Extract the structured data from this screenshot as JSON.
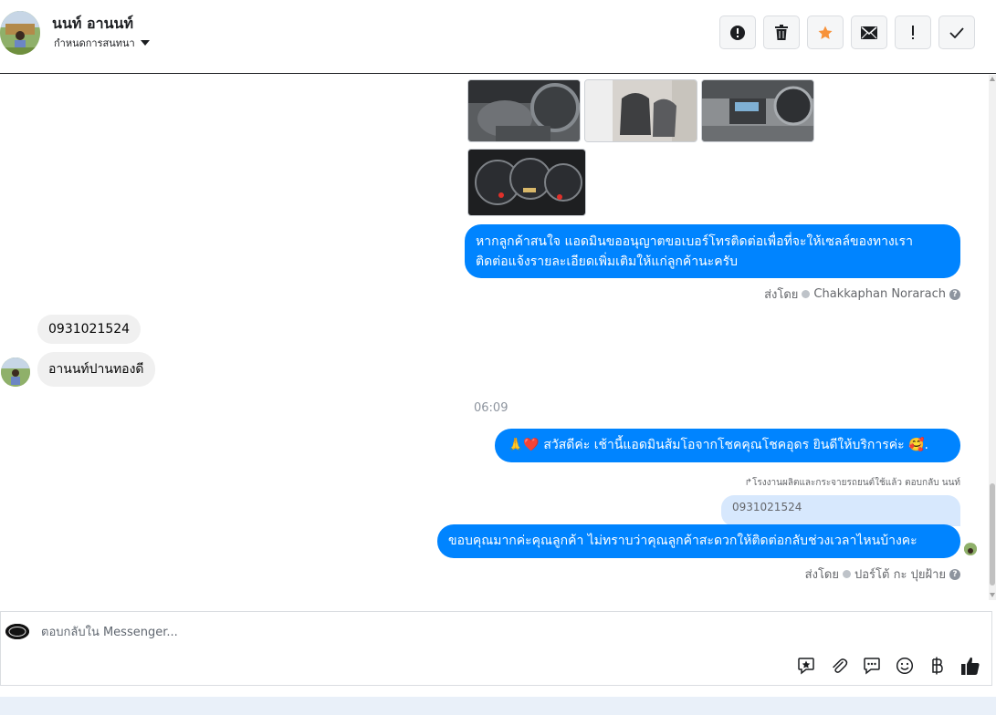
{
  "header": {
    "contact_name": "นนท์ อานนท์",
    "status_label": "กำหนดการสนทนา",
    "actions": [
      {
        "id": "spam",
        "icon": "alert-circle-icon"
      },
      {
        "id": "delete",
        "icon": "trash-icon"
      },
      {
        "id": "star",
        "icon": "star-icon"
      },
      {
        "id": "mail",
        "icon": "envelope-icon"
      },
      {
        "id": "important",
        "icon": "exclamation-icon"
      },
      {
        "id": "done",
        "icon": "check-icon"
      }
    ],
    "accent_color": "#f7923a"
  },
  "conversation": {
    "photos": [
      {
        "name": "car-photo-shifter"
      },
      {
        "name": "car-photo-seats"
      },
      {
        "name": "car-photo-dashboard"
      },
      {
        "name": "car-photo-gauges"
      }
    ],
    "msg1": {
      "line1": "หากลูกค้าสนใจ แอดมินขออนุญาตขอเบอร์โทรติดต่อเพื่อที่จะให้เซลล์ของทางเรา",
      "line2": "ติดต่อแจ้งรายละเอียดเพิ่มเติมให้แก่ลูกค้านะครับ",
      "sent_prefix": "ส่งโดย",
      "sent_by": "Chakkaphan Norarach"
    },
    "incoming1": "0931021524",
    "incoming2": "อานนท์ปานทองดี",
    "time": "06:09",
    "msg2": {
      "text": "🙏❤️ สวัสดีค่ะ เช้านี้แอดมินส้มโอจากโชคคุณโชคอุดร ยินดีให้บริการค่ะ  🥰."
    },
    "reply_note": "↱โรงงานผลิตและกระจายรถยนต์ใช้แล้ว ตอบกลับ นนท์",
    "quoted": "0931021524",
    "msg3": {
      "text": "ขอบคุณมากค่ะคุณลูกค้า ไม่ทราบว่าคุณลูกค้าสะดวกให้ติดต่อกลับช่วงเวลาไหนบ้างคะ",
      "sent_prefix": "ส่งโดย",
      "sent_by": "ปอร์โต้ กะ ปุยฝ้าย"
    },
    "bubble_color": "#0084ff"
  },
  "composer": {
    "placeholder": "ตอบกลับใน Messenger...",
    "tools": [
      "sticker-star-icon",
      "paperclip-icon",
      "saved-reply-icon",
      "emoji-icon",
      "baht-icon",
      "thumbs-up-icon"
    ]
  }
}
